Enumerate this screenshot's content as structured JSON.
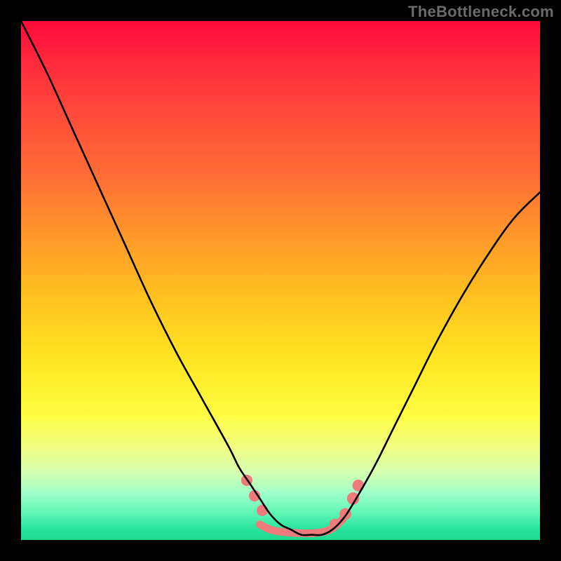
{
  "watermark": "TheBottleneck.com",
  "chart_data": {
    "type": "line",
    "title": "",
    "xlabel": "",
    "ylabel": "",
    "xlim": [
      0,
      100
    ],
    "ylim": [
      0,
      100
    ],
    "grid": false,
    "legend": false,
    "background_gradient": {
      "top_color": "#ff0a3c",
      "bottom_color": "#1fd98f",
      "midpoint_color": "#ffe724"
    },
    "series": [
      {
        "name": "bottleneck-curve",
        "color": "#000000",
        "x": [
          0,
          5,
          10,
          15,
          20,
          25,
          30,
          35,
          40,
          42,
          44,
          46,
          48,
          50,
          52,
          54,
          56,
          58,
          60,
          62,
          64,
          68,
          72,
          76,
          80,
          85,
          90,
          95,
          100
        ],
        "values": [
          100,
          90,
          79,
          68,
          57,
          46,
          36,
          27,
          18,
          14,
          11,
          8,
          5,
          3,
          2,
          1,
          1,
          1,
          2,
          4,
          7,
          14,
          22,
          30,
          38,
          47,
          55,
          62,
          67
        ]
      },
      {
        "name": "flat-segment",
        "color": "#ed7b7b",
        "x": [
          46,
          48,
          50,
          52,
          54,
          56,
          58,
          60,
          62
        ],
        "values": [
          3,
          2,
          1.6,
          1.4,
          1.3,
          1.3,
          1.5,
          2.2,
          4
        ]
      }
    ],
    "markers": [
      {
        "name": "left-dot-1",
        "x": 43.5,
        "y": 11.5,
        "r": 1.1,
        "color": "#ed7b7b"
      },
      {
        "name": "left-dot-2",
        "x": 45.0,
        "y": 8.5,
        "r": 1.1,
        "color": "#ed7b7b"
      },
      {
        "name": "left-dot-3",
        "x": 46.5,
        "y": 5.7,
        "r": 1.1,
        "color": "#ed7b7b"
      },
      {
        "name": "right-dot-1",
        "x": 60.5,
        "y": 3.0,
        "r": 1.1,
        "color": "#ed7b7b"
      },
      {
        "name": "right-dot-2",
        "x": 62.5,
        "y": 5.0,
        "r": 1.2,
        "color": "#ed7b7b"
      },
      {
        "name": "right-dot-3",
        "x": 64.0,
        "y": 8.0,
        "r": 1.3,
        "color": "#ed7b7b"
      },
      {
        "name": "right-dot-4",
        "x": 65.0,
        "y": 10.5,
        "r": 1.2,
        "color": "#ed7b7b"
      }
    ]
  }
}
